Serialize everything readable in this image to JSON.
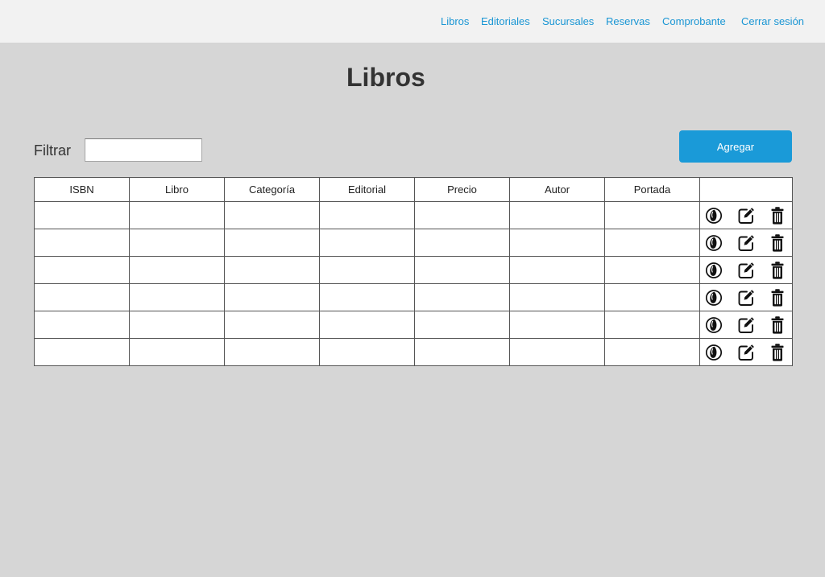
{
  "nav": {
    "links": [
      "Libros",
      "Editoriales",
      "Sucursales",
      "Reservas",
      "Comprobante",
      "Cerrar sesión"
    ]
  },
  "page": {
    "title": "Libros"
  },
  "filter": {
    "label": "Filtrar",
    "value": ""
  },
  "actions": {
    "add_label": "Agregar"
  },
  "table": {
    "headers": [
      "ISBN",
      "Libro",
      "Categoría",
      "Editorial",
      "Precio",
      "Autor",
      "Portada",
      ""
    ],
    "rows": [
      {
        "isbn": "",
        "libro": "",
        "categoria": "",
        "editorial": "",
        "precio": "",
        "autor": "",
        "portada": ""
      },
      {
        "isbn": "",
        "libro": "",
        "categoria": "",
        "editorial": "",
        "precio": "",
        "autor": "",
        "portada": ""
      },
      {
        "isbn": "",
        "libro": "",
        "categoria": "",
        "editorial": "",
        "precio": "",
        "autor": "",
        "portada": ""
      },
      {
        "isbn": "",
        "libro": "",
        "categoria": "",
        "editorial": "",
        "precio": "",
        "autor": "",
        "portada": ""
      },
      {
        "isbn": "",
        "libro": "",
        "categoria": "",
        "editorial": "",
        "precio": "",
        "autor": "",
        "portada": ""
      },
      {
        "isbn": "",
        "libro": "",
        "categoria": "",
        "editorial": "",
        "precio": "",
        "autor": "",
        "portada": ""
      }
    ],
    "row_icons": [
      "view-icon",
      "edit-icon",
      "delete-icon"
    ]
  },
  "colors": {
    "accent": "#1a9ad8",
    "nav_link": "#1a96d4",
    "navbar_bg": "#f2f2f2",
    "page_bg": "#d6d6d6"
  }
}
